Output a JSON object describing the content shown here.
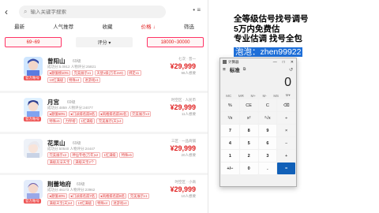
{
  "search": {
    "back": "‹",
    "placeholder": "输入关键字搜索",
    "menu": "•  ≡"
  },
  "tabs": [
    "最新",
    "人气推荐",
    "收藏",
    "价格 ↓",
    "筛选"
  ],
  "filters": {
    "min_price": "69~69",
    "sort": "评分 ▾",
    "price_range": "18000~30000"
  },
  "listings": [
    {
      "name": "曾阳山",
      "rank": "69级",
      "meta": "成功分:5.0912 人物评分:25821",
      "right_top": "七次 · 普一",
      "price": "¥29,999",
      "right_sub": "98人想要",
      "avatar_tag": "官方账号",
      "tags1": [
        "●颜值榜10%",
        "完美展示x1",
        "天使1级(万年2x9)",
        "绑定x1"
      ],
      "tags2": [
        "10红满级",
        "特殊x4",
        "进游戏x1"
      ]
    },
    {
      "name": "月宫",
      "rank": "69级",
      "meta": "成功分:4859 人物评分:24077",
      "right_top": "时空区 · 人民币",
      "price": "¥29,999",
      "right_sub": "11人想要",
      "avatar_tag": "官方账号",
      "tags1": [
        "●颜值50%",
        "●门派排名前8名",
        "●风格排名前31名",
        "完美展示x3"
      ],
      "tags2": [
        "特殊x5",
        "力悍榜",
        "1红满级",
        "完美展示(天)x4"
      ]
    },
    {
      "name": "花果山",
      "rank": "69级",
      "meta": "成功分:50540 人物评分:24447",
      "right_top": "三区 · 一品商铺",
      "price": "¥29,999",
      "right_sub": "20人想要",
      "avatar_tag": "",
      "tags1": [
        "完美展示x2",
        "神仙专柜(万年)x2",
        "1红满级",
        "特殊x5"
      ],
      "tags2": [
        "满级兵法天宝",
        "满级天宝2个"
      ]
    },
    {
      "name": "荆蕾地府",
      "rank": "69级",
      "meta": "成功分:46173 人物评分:23962",
      "right_top": "时空区 · 小商",
      "price": "¥29,999",
      "right_sub": "10人想要",
      "avatar_tag": "官方账号",
      "tags1": [
        "●颜值40%",
        "●门派排名前7名",
        "●风格排名前8名",
        "完美展示x1"
      ],
      "tags2": [
        "满级天宝(天)x4",
        "10红满级",
        "特殊x4",
        "进游戏x4"
      ]
    }
  ],
  "document": {
    "line1": "全等级估号找号调号",
    "line2": "5万内免费估",
    "line3": "专业估调 找号全包",
    "line4": "泡泡：zhen99922"
  },
  "calculator": {
    "title": "计算器",
    "mode": "标准",
    "display": "0",
    "memory": [
      "MC",
      "MR",
      "M+",
      "M-",
      "MS",
      "M▾"
    ],
    "keys": [
      "%",
      "CE",
      "C",
      "⌫",
      "¹/x",
      "x²",
      "²√x",
      "÷",
      "7",
      "8",
      "9",
      "×",
      "4",
      "5",
      "6",
      "−",
      "1",
      "2",
      "3",
      "+",
      "+/−",
      "0",
      ".",
      "="
    ],
    "accent": "#1160b8"
  }
}
